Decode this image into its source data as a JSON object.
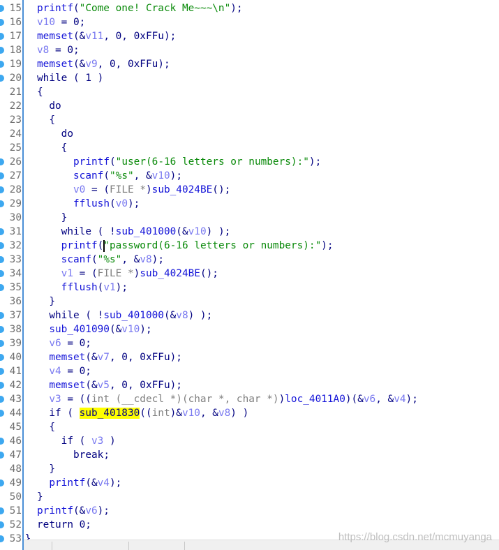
{
  "editor": {
    "lines": [
      {
        "n": "15",
        "dot": true,
        "indent": 0,
        "tokens": [
          [
            "f",
            "printf"
          ],
          [
            "p",
            "("
          ],
          [
            "s",
            "\"Come one! Crack Me~~~\\n\""
          ],
          [
            "p",
            ");"
          ]
        ]
      },
      {
        "n": "16",
        "dot": true,
        "indent": 0,
        "tokens": [
          [
            "v",
            "v10"
          ],
          [
            "p",
            " = 0;"
          ]
        ]
      },
      {
        "n": "17",
        "dot": true,
        "indent": 0,
        "tokens": [
          [
            "f",
            "memset"
          ],
          [
            "p",
            "(&"
          ],
          [
            "v",
            "v11"
          ],
          [
            "p",
            ", 0, 0xFFu);"
          ]
        ]
      },
      {
        "n": "18",
        "dot": true,
        "indent": 0,
        "tokens": [
          [
            "v",
            "v8"
          ],
          [
            "p",
            " = 0;"
          ]
        ]
      },
      {
        "n": "19",
        "dot": true,
        "indent": 0,
        "tokens": [
          [
            "f",
            "memset"
          ],
          [
            "p",
            "(&"
          ],
          [
            "v",
            "v9"
          ],
          [
            "p",
            ", 0, 0xFFu);"
          ]
        ]
      },
      {
        "n": "20",
        "dot": true,
        "indent": 0,
        "tokens": [
          [
            "k",
            "while"
          ],
          [
            "p",
            " ( 1 )"
          ]
        ]
      },
      {
        "n": "21",
        "dot": false,
        "indent": 0,
        "tokens": [
          [
            "p",
            "{"
          ]
        ]
      },
      {
        "n": "22",
        "dot": false,
        "indent": 2,
        "tokens": [
          [
            "k",
            "do"
          ]
        ]
      },
      {
        "n": "23",
        "dot": false,
        "indent": 2,
        "tokens": [
          [
            "p",
            "{"
          ]
        ]
      },
      {
        "n": "24",
        "dot": false,
        "indent": 4,
        "tokens": [
          [
            "k",
            "do"
          ]
        ]
      },
      {
        "n": "25",
        "dot": false,
        "indent": 4,
        "tokens": [
          [
            "p",
            "{"
          ]
        ]
      },
      {
        "n": "26",
        "dot": true,
        "indent": 6,
        "tokens": [
          [
            "f",
            "printf"
          ],
          [
            "p",
            "("
          ],
          [
            "s",
            "\"user(6-16 letters or numbers):\""
          ],
          [
            "p",
            ");"
          ]
        ]
      },
      {
        "n": "27",
        "dot": true,
        "indent": 6,
        "tokens": [
          [
            "f",
            "scanf"
          ],
          [
            "p",
            "("
          ],
          [
            "s",
            "\"%s\""
          ],
          [
            "p",
            ", &"
          ],
          [
            "v",
            "v10"
          ],
          [
            "p",
            ");"
          ]
        ]
      },
      {
        "n": "28",
        "dot": true,
        "indent": 6,
        "tokens": [
          [
            "v",
            "v0"
          ],
          [
            "p",
            " = ("
          ],
          [
            "c",
            "FILE *"
          ],
          [
            "p",
            ")"
          ],
          [
            "f",
            "sub_4024BE"
          ],
          [
            "p",
            "();"
          ]
        ]
      },
      {
        "n": "29",
        "dot": true,
        "indent": 6,
        "tokens": [
          [
            "f",
            "fflush"
          ],
          [
            "p",
            "("
          ],
          [
            "v",
            "v0"
          ],
          [
            "p",
            ");"
          ]
        ]
      },
      {
        "n": "30",
        "dot": false,
        "indent": 4,
        "tokens": [
          [
            "p",
            "}"
          ]
        ]
      },
      {
        "n": "31",
        "dot": true,
        "indent": 4,
        "tokens": [
          [
            "k",
            "while"
          ],
          [
            "p",
            " ( !"
          ],
          [
            "f",
            "sub_401000"
          ],
          [
            "p",
            "(&"
          ],
          [
            "v",
            "v10"
          ],
          [
            "p",
            ") );"
          ]
        ]
      },
      {
        "n": "32",
        "dot": true,
        "indent": 4,
        "cursor_after": 1,
        "tokens": [
          [
            "f",
            "printf"
          ],
          [
            "p",
            "("
          ],
          [
            "s",
            "\"password(6-16 letters or numbers):\""
          ],
          [
            "p",
            ");"
          ]
        ]
      },
      {
        "n": "33",
        "dot": true,
        "indent": 4,
        "tokens": [
          [
            "f",
            "scanf"
          ],
          [
            "p",
            "("
          ],
          [
            "s",
            "\"%s\""
          ],
          [
            "p",
            ", &"
          ],
          [
            "v",
            "v8"
          ],
          [
            "p",
            ");"
          ]
        ]
      },
      {
        "n": "34",
        "dot": true,
        "indent": 4,
        "tokens": [
          [
            "v",
            "v1"
          ],
          [
            "p",
            " = ("
          ],
          [
            "c",
            "FILE *"
          ],
          [
            "p",
            ")"
          ],
          [
            "f",
            "sub_4024BE"
          ],
          [
            "p",
            "();"
          ]
        ]
      },
      {
        "n": "35",
        "dot": true,
        "indent": 4,
        "tokens": [
          [
            "f",
            "fflush"
          ],
          [
            "p",
            "("
          ],
          [
            "v",
            "v1"
          ],
          [
            "p",
            ");"
          ]
        ]
      },
      {
        "n": "36",
        "dot": false,
        "indent": 2,
        "tokens": [
          [
            "p",
            "}"
          ]
        ]
      },
      {
        "n": "37",
        "dot": true,
        "indent": 2,
        "tokens": [
          [
            "k",
            "while"
          ],
          [
            "p",
            " ( !"
          ],
          [
            "f",
            "sub_401000"
          ],
          [
            "p",
            "(&"
          ],
          [
            "v",
            "v8"
          ],
          [
            "p",
            ") );"
          ]
        ]
      },
      {
        "n": "38",
        "dot": true,
        "indent": 2,
        "tokens": [
          [
            "f",
            "sub_401090"
          ],
          [
            "p",
            "(&"
          ],
          [
            "v",
            "v10"
          ],
          [
            "p",
            ");"
          ]
        ]
      },
      {
        "n": "39",
        "dot": true,
        "indent": 2,
        "tokens": [
          [
            "v",
            "v6"
          ],
          [
            "p",
            " = 0;"
          ]
        ]
      },
      {
        "n": "40",
        "dot": true,
        "indent": 2,
        "tokens": [
          [
            "f",
            "memset"
          ],
          [
            "p",
            "(&"
          ],
          [
            "v",
            "v7"
          ],
          [
            "p",
            ", 0, 0xFFu);"
          ]
        ]
      },
      {
        "n": "41",
        "dot": true,
        "indent": 2,
        "tokens": [
          [
            "v",
            "v4"
          ],
          [
            "p",
            " = 0;"
          ]
        ]
      },
      {
        "n": "42",
        "dot": true,
        "indent": 2,
        "tokens": [
          [
            "f",
            "memset"
          ],
          [
            "p",
            "(&"
          ],
          [
            "v",
            "v5"
          ],
          [
            "p",
            ", 0, 0xFFu);"
          ]
        ]
      },
      {
        "n": "43",
        "dot": true,
        "indent": 2,
        "tokens": [
          [
            "v",
            "v3"
          ],
          [
            "p",
            " = (("
          ],
          [
            "c",
            "int (__cdecl *)(char *, char *)"
          ],
          [
            "p",
            ")"
          ],
          [
            "f",
            "loc_4011A0"
          ],
          [
            "p",
            ")(&"
          ],
          [
            "v",
            "v6"
          ],
          [
            "p",
            ", &"
          ],
          [
            "v",
            "v4"
          ],
          [
            "p",
            ");"
          ]
        ]
      },
      {
        "n": "44",
        "dot": true,
        "indent": 2,
        "tokens": [
          [
            "k",
            "if"
          ],
          [
            "p",
            " ( "
          ],
          [
            "hl",
            "sub_401830"
          ],
          [
            "p",
            "(("
          ],
          [
            "c",
            "int"
          ],
          [
            "p",
            ")&"
          ],
          [
            "v",
            "v10"
          ],
          [
            "p",
            ", &"
          ],
          [
            "v",
            "v8"
          ],
          [
            "p",
            ") )"
          ]
        ]
      },
      {
        "n": "45",
        "dot": false,
        "indent": 2,
        "tokens": [
          [
            "p",
            "{"
          ]
        ]
      },
      {
        "n": "46",
        "dot": true,
        "indent": 4,
        "tokens": [
          [
            "k",
            "if"
          ],
          [
            "p",
            " ( "
          ],
          [
            "v",
            "v3"
          ],
          [
            "p",
            " )"
          ]
        ]
      },
      {
        "n": "47",
        "dot": true,
        "indent": 6,
        "tokens": [
          [
            "k",
            "break"
          ],
          [
            "p",
            ";"
          ]
        ]
      },
      {
        "n": "48",
        "dot": false,
        "indent": 2,
        "tokens": [
          [
            "p",
            "}"
          ]
        ]
      },
      {
        "n": "49",
        "dot": true,
        "indent": 2,
        "tokens": [
          [
            "f",
            "printf"
          ],
          [
            "p",
            "(&"
          ],
          [
            "v",
            "v4"
          ],
          [
            "p",
            ");"
          ]
        ]
      },
      {
        "n": "50",
        "dot": false,
        "indent": 0,
        "tokens": [
          [
            "p",
            "}"
          ]
        ]
      },
      {
        "n": "51",
        "dot": true,
        "indent": 0,
        "tokens": [
          [
            "f",
            "printf"
          ],
          [
            "p",
            "(&"
          ],
          [
            "v",
            "v6"
          ],
          [
            "p",
            ");"
          ]
        ]
      },
      {
        "n": "52",
        "dot": true,
        "indent": 0,
        "tokens": [
          [
            "k",
            "return"
          ],
          [
            "p",
            " 0;"
          ]
        ]
      },
      {
        "n": "53",
        "dot": true,
        "indent": -2,
        "tokens": [
          [
            "p",
            "}"
          ]
        ]
      }
    ]
  },
  "watermark": "https://blog.csdn.net/mcmuyanga",
  "colors": {
    "function": "#1414d8",
    "keyword": "#000080",
    "variable": "#7878f0",
    "string": "#0a8a0a",
    "cast": "#808080",
    "highlight": "#ffff00",
    "breakpoint_dot": "#3da8f0"
  }
}
